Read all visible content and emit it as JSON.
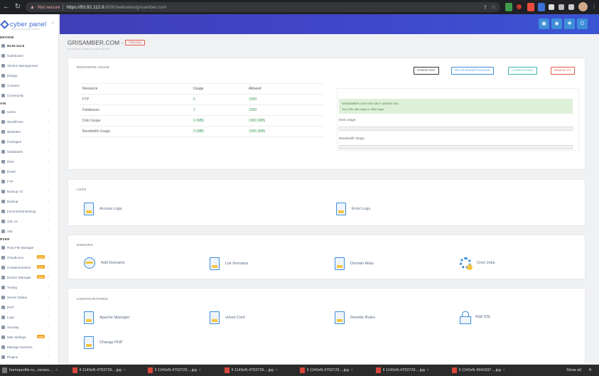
{
  "browser": {
    "not_secure": "Not secure",
    "url_host": "https://93.92.112.8",
    "url_rest": ":8090/websites/grisamber.com"
  },
  "brand": {
    "name": "cyber panel",
    "sub": "WEB HOSTING PANEL"
  },
  "colors": {
    "accent": "#3e8ed8",
    "header": "#4046c8",
    "danger": "#e05a4a",
    "success": "#3c9a54"
  },
  "sidebar": {
    "sections": {
      "overview": "ERVIEW",
      "main": "AIN",
      "server": "RVER"
    },
    "ip": "93.92.112.8",
    "overview_items": [
      "Dashboard",
      "Version Management",
      "Design",
      "Connect",
      "Community"
    ],
    "main_items": [
      "Users",
      "WordPress",
      "Websites",
      "Packages",
      "Databases",
      "DNS",
      "Email",
      "FTP",
      "Backup V2",
      "Backup",
      "Incremental Backup",
      "SSL v2",
      "SSL"
    ],
    "server_items": [
      {
        "label": "Root File Manager",
        "new": false,
        "arrow": false
      },
      {
        "label": "CloudLinux",
        "new": true,
        "arrow": true
      },
      {
        "label": "Containerization",
        "new": true,
        "arrow": true
      },
      {
        "label": "Docker Manager",
        "new": true,
        "arrow": true
      },
      {
        "label": "Tuning",
        "new": false,
        "arrow": true
      },
      {
        "label": "Server Status",
        "new": false,
        "arrow": true
      },
      {
        "label": "PHP",
        "new": false,
        "arrow": true
      },
      {
        "label": "Logs",
        "new": false,
        "arrow": true
      },
      {
        "label": "Security",
        "new": false,
        "arrow": true
      },
      {
        "label": "Mail Settings",
        "new": true,
        "arrow": true
      },
      {
        "label": "Manage Services",
        "new": false,
        "arrow": true
      },
      {
        "label": "Plugins",
        "new": false,
        "arrow": true
      }
    ],
    "new_badge": "NEW"
  },
  "page": {
    "title": "GRISAMBER.COM -",
    "preview": "PREVIEW",
    "subtitle": "All functions related to a particular site."
  },
  "resource": {
    "title": "RESOURCE USAGE",
    "buttons": {
      "stress": "STRESS TEST",
      "ssh": "SET UP SSH/SFTP ACCESS",
      "clone": "CLONE/STAGING",
      "git": "MANAGE GIT"
    },
    "headers": [
      "Resource",
      "Usage",
      "Allowed"
    ],
    "rows": [
      {
        "resource": "FTP",
        "usage": "0",
        "allowed": "1000"
      },
      {
        "resource": "Databases",
        "usage": "1",
        "allowed": "1000"
      },
      {
        "resource": "Disk Usage",
        "usage": "0 (MB)",
        "allowed": "1000 (MB)"
      },
      {
        "resource": "Bandwidth Usage",
        "usage": "0 (MB)",
        "allowed": "1000 (MB)"
      }
    ],
    "ssl_title": "GRISAMBER.COM HAS SELF-SIGNED SSL.",
    "ssl_expiry": "Your SSL will expire in 3649 days.",
    "disk_label": "Disk Usage",
    "disk_percent": 0,
    "bandwidth_label": "Bandwidth Usage",
    "bandwidth_percent": 0
  },
  "logs": {
    "title": "LOGS",
    "access": "Access Logs",
    "error": "Error Logs"
  },
  "domains": {
    "title": "DOMAINS",
    "add": "Add Domains",
    "list": "List Domains",
    "alias": "Domain Alias",
    "cron": "Cron Jobs"
  },
  "config": {
    "title": "CONFIGURATIONS",
    "apache": "Apache Manager",
    "vhost": "vHost Conf",
    "rewrite": "Rewrite Rules",
    "ssl": "Add SSL",
    "php": "Change PHP"
  },
  "taskbar": {
    "items": [
      "homeprofile.ru...verass....",
      "ll 1140xN.4793729....jpg",
      "ll 1140xN.4793729....jpg",
      "ll 1140xN.4793729....jpg",
      "ll 1140xN.4793729....jpg",
      "ll 1140xN.4793729....jpg",
      "ll 1140xN.4941997....jpg"
    ],
    "show_all": "Show all"
  }
}
